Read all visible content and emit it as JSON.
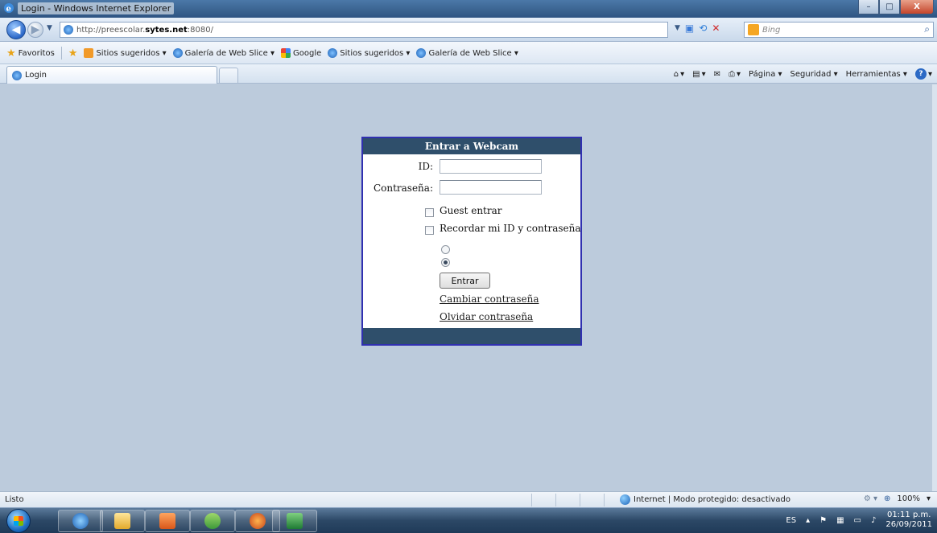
{
  "window": {
    "title": "Login - Windows Internet Explorer",
    "minimize": "–",
    "maximize": "□",
    "close": "X"
  },
  "address_bar": {
    "url_prefix": "http://preescolar.",
    "url_domain": "sytes.net",
    "url_suffix": ":8080/",
    "search_placeholder": "Bing"
  },
  "favorites_bar": {
    "favorites_label": "Favoritos",
    "items": [
      {
        "label": "Sitios sugeridos ▾"
      },
      {
        "label": "Galería de Web Slice ▾"
      },
      {
        "label": "Google"
      },
      {
        "label": "Sitios sugeridos ▾"
      },
      {
        "label": "Galería de Web Slice ▾"
      }
    ]
  },
  "tabs": [
    {
      "label": "Login"
    }
  ],
  "command_bar": {
    "page": "Página ▾",
    "security": "Seguridad ▾",
    "tools": "Herramientas ▾",
    "help": "?"
  },
  "login": {
    "title": "Entrar a Webcam",
    "id_label": "ID:",
    "password_label": "Contraseña:",
    "guest_label": "Guest entrar",
    "remember_label": "Recordar mi ID y contraseña",
    "submit_label": "Entrar",
    "change_password": "Cambiar contraseña",
    "forgot_password": "Olvidar contraseña",
    "id_value": "",
    "password_value": "",
    "guest_checked": false,
    "remember_checked": false,
    "radio_selected_index": 1
  },
  "status_bar": {
    "status": "Listo",
    "zone": "Internet | Modo protegido: desactivado",
    "zoom": "100%"
  },
  "taskbar": {
    "language": "ES",
    "time": "01:11 p.m.",
    "date": "26/09/2011"
  }
}
